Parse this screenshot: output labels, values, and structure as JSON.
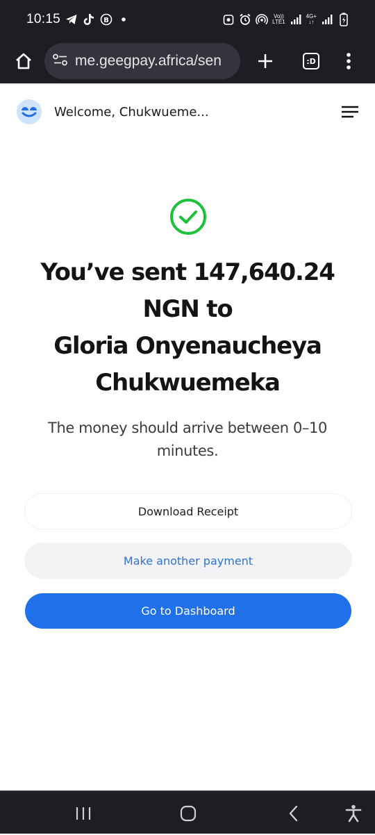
{
  "status_bar": {
    "time": "10:15",
    "notification_icons": [
      "telegram-icon",
      "tiktok-icon",
      "b-icon",
      "dot-icon"
    ],
    "network_label_1_top": "Vo))",
    "network_label_1_bottom": "LTE1",
    "network_label_2_top": "4G+",
    "network_label_2_bottom": "↓↑"
  },
  "browser": {
    "url": "me.geegpay.africa/sen",
    "tab_count": ":D"
  },
  "header": {
    "welcome": "Welcome, Chukwueme..."
  },
  "main": {
    "headline_line1": "You’ve sent 147,640.24",
    "headline_line2": "NGN to",
    "headline_line3": "Gloria Onyenaucheya",
    "headline_line4": "Chukwuemeka",
    "subtext_line1": "The money should arrive between 0–10",
    "subtext_line2": "minutes."
  },
  "actions": {
    "download_receipt": "Download Receipt",
    "make_another_payment": "Make another payment",
    "go_to_dashboard": "Go to Dashboard"
  },
  "colors": {
    "success_green": "#20c13a",
    "primary_blue": "#2070ea",
    "link_blue": "#2f74d6",
    "chrome_dark": "#1d1d24"
  }
}
